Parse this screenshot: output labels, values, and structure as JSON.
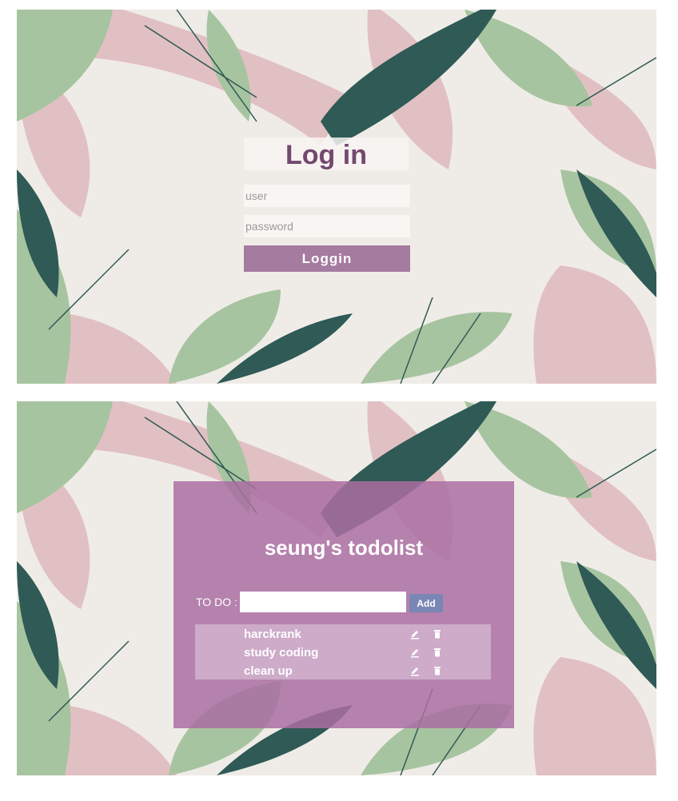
{
  "login": {
    "title": "Log in",
    "user_placeholder": "user",
    "password_placeholder": "password",
    "button_label": "Loggin"
  },
  "todo": {
    "title": "seung's todolist",
    "input_label": "TO DO :",
    "input_value": "",
    "add_label": "Add",
    "items": [
      {
        "text": "harckrank"
      },
      {
        "text": "study coding"
      },
      {
        "text": "clean up"
      }
    ],
    "item_actions": {
      "edit_icon": "pencil-icon",
      "delete_icon": "trash-icon"
    }
  },
  "colors": {
    "background": "#efece7",
    "accent": "#a57ba0",
    "title": "#74486e",
    "panel": "#aa6ea2",
    "add_button": "#7a87b4",
    "leaf_green": "#a7c4a0",
    "leaf_dark": "#2f5a55",
    "leaf_pink": "#e1c0c3"
  }
}
